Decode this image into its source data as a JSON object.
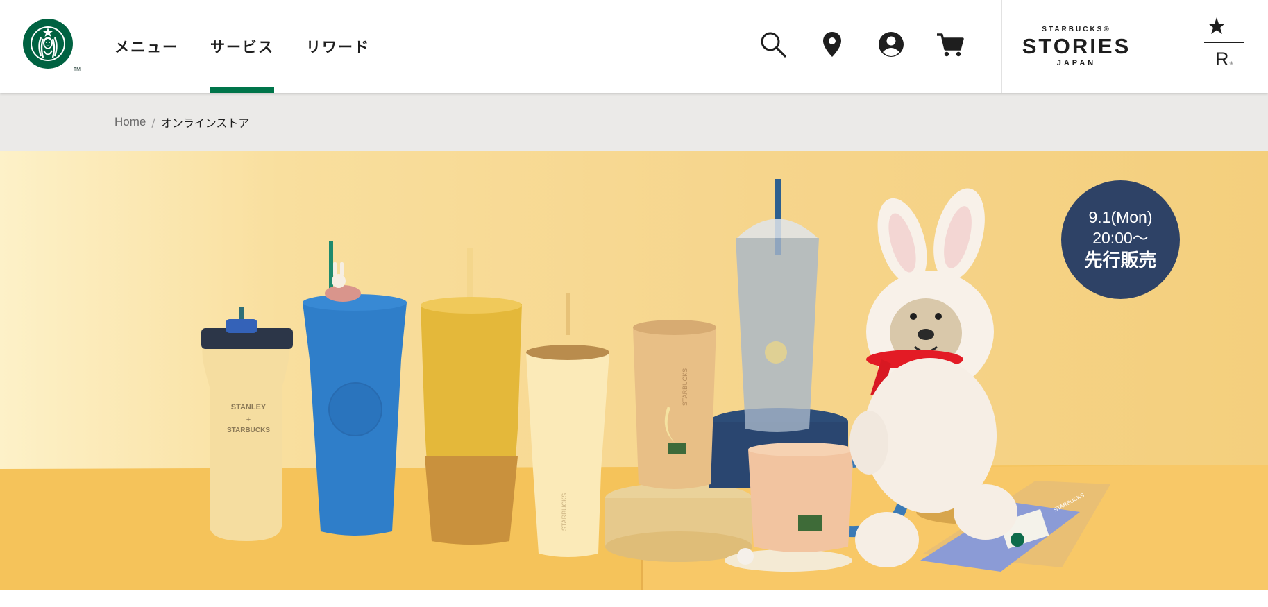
{
  "header": {
    "logo": {
      "name": "starbucks-siren-logo",
      "tm": "TM"
    },
    "nav": [
      {
        "label": "メニュー",
        "active": false
      },
      {
        "label": "サービス",
        "active": true
      },
      {
        "label": "リワード",
        "active": false
      }
    ],
    "icons": [
      "search-icon",
      "store-location-icon",
      "account-icon",
      "cart-icon"
    ],
    "stories": {
      "top": "STARBUCKS®",
      "middle": "STORIES",
      "bottom": "JAPAN"
    },
    "reserve": {
      "letter": "R",
      "tm": "®",
      "icon": "star-icon"
    }
  },
  "breadcrumb": {
    "home": "Home",
    "separator": "/",
    "current": "オンラインストア"
  },
  "hero": {
    "badge": {
      "line1": "9.1(Mon)",
      "line2": "20:00〜",
      "line3": "先行販売"
    },
    "product_labels": {
      "stanley_top": "STANLEY",
      "stanley_plus": "+",
      "stanley_bottom": "STARBUCKS",
      "tumbler_brand": "STARBUCKS",
      "cup_brand": "STARBUCKS",
      "card_brand": "STARBUCKS"
    }
  },
  "colors": {
    "accent_green": "#00754a",
    "siren_green": "#006241",
    "badge_navy": "#2e4266",
    "breadcrumb_bg": "#ebeae8",
    "hero_bg": "#f6d58c"
  }
}
